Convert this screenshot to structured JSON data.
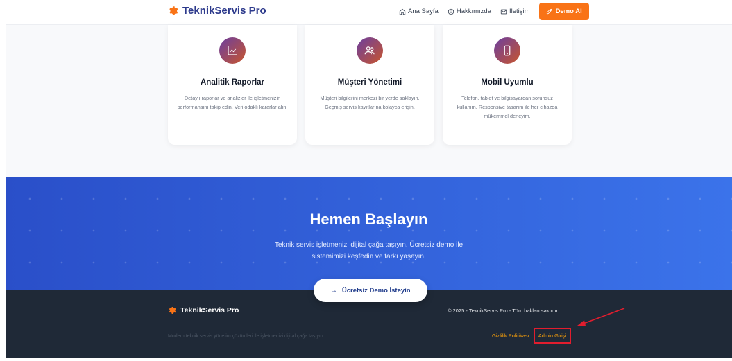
{
  "navbar": {
    "brand": "TeknikServis Pro",
    "links": [
      {
        "label": "Ana Sayfa",
        "icon": "home-icon"
      },
      {
        "label": "Hakkımızda",
        "icon": "info-icon"
      },
      {
        "label": "İletişim",
        "icon": "mail-icon"
      }
    ],
    "demo_label": "Demo Al"
  },
  "features": [
    {
      "title": "Analitik Raporlar",
      "desc": "Detaylı raporlar ve analizler ile işletmenizin performansını takip edin. Veri odaklı kararlar alın.",
      "icon": "chart-line-icon"
    },
    {
      "title": "Müşteri Yönetimi",
      "desc": "Müşteri bilgilerini merkezi bir yerde saklayın. Geçmiş servis kayıtlarına kolayca erişin.",
      "icon": "users-icon"
    },
    {
      "title": "Mobil Uyumlu",
      "desc": "Telefon, tablet ve bilgisayardan sorunsuz kullanım. Responsive tasarım ile her cihazda mükemmel deneyim.",
      "icon": "mobile-icon"
    }
  ],
  "cta": {
    "title": "Hemen Başlayın",
    "desc_line1": "Teknik servis işletmenizi dijital çağa taşıyın. Ücretsiz demo ile",
    "desc_line2": "sistemimizi keşfedin ve farkı yaşayın.",
    "button_label": "Ücretsiz Demo İsteyin",
    "button_icon": "→"
  },
  "footer": {
    "brand": "TeknikServis Pro",
    "copyright": "© 2025 - TeknikServis Pro - Tüm hakları saklıdır.",
    "tagline": "Modern teknik servis yönetim çözümleri ile işletmenizi dijital çağa taşıyın.",
    "privacy_label": "Gizlilik Politikası",
    "admin_label": "Admin Girişi"
  },
  "colors": {
    "brand": "#2d3a8c",
    "accent": "#f97316",
    "cta_blue": "#2f5fd8",
    "footer_bg": "#1f2937",
    "annotation_red": "#e11d2e"
  }
}
